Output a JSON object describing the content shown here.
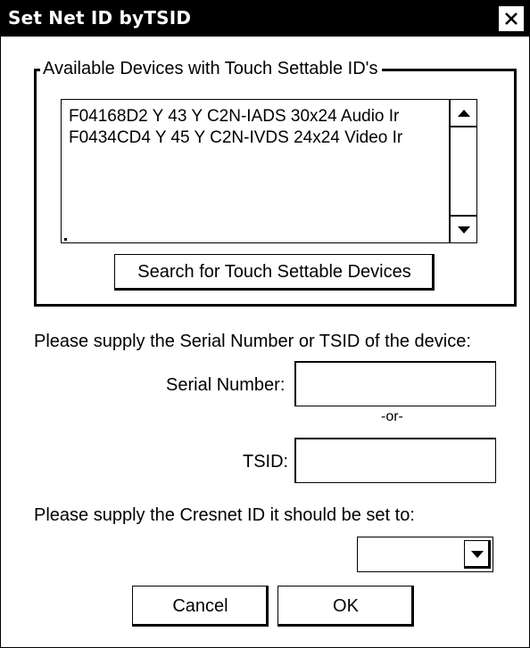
{
  "window": {
    "title": "Set Net ID byTSID",
    "close_icon": "close-icon"
  },
  "devices_group": {
    "legend": "Available Devices with Touch Settable ID's",
    "items": [
      "F04168D2 Y 43 Y C2N-IADS 30x24 Audio Ir",
      "F0434CD4 Y 45 Y C2N-IVDS 24x24 Video Ir"
    ],
    "search_button": "Search for Touch Settable Devices"
  },
  "serial_prompt": "Please supply the Serial Number or TSID of the device:",
  "serial_number": {
    "label": "Serial Number:",
    "value": ""
  },
  "or_text": "-or-",
  "tsid": {
    "label": "TSID:",
    "value": ""
  },
  "cresnet_prompt": "Please supply the Cresnet ID it should be set to:",
  "cresnet_select": {
    "selected": ""
  },
  "buttons": {
    "cancel": "Cancel",
    "ok": "OK"
  }
}
